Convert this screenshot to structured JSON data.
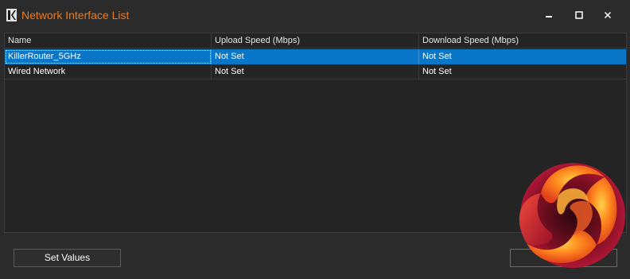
{
  "window": {
    "title": "Network Interface List",
    "icon": "killer-logo-icon"
  },
  "controls": {
    "minimize": "minimize-icon",
    "maximize": "maximize-icon",
    "close": "close-icon"
  },
  "table": {
    "columns": [
      "Name",
      "Upload Speed (Mbps)",
      "Download Speed (Mbps)"
    ],
    "rows": [
      {
        "name": "KillerRouter_5GHz",
        "upload": "Not Set",
        "download": "Not Set",
        "selected": true
      },
      {
        "name": "Wired Network",
        "upload": "Not Set",
        "download": "Not Set",
        "selected": false
      }
    ]
  },
  "buttons": {
    "set_values": "Set Values"
  },
  "colors": {
    "accent": "#f07a1a",
    "selection": "#0a76c8",
    "background": "#2b2b2b"
  }
}
